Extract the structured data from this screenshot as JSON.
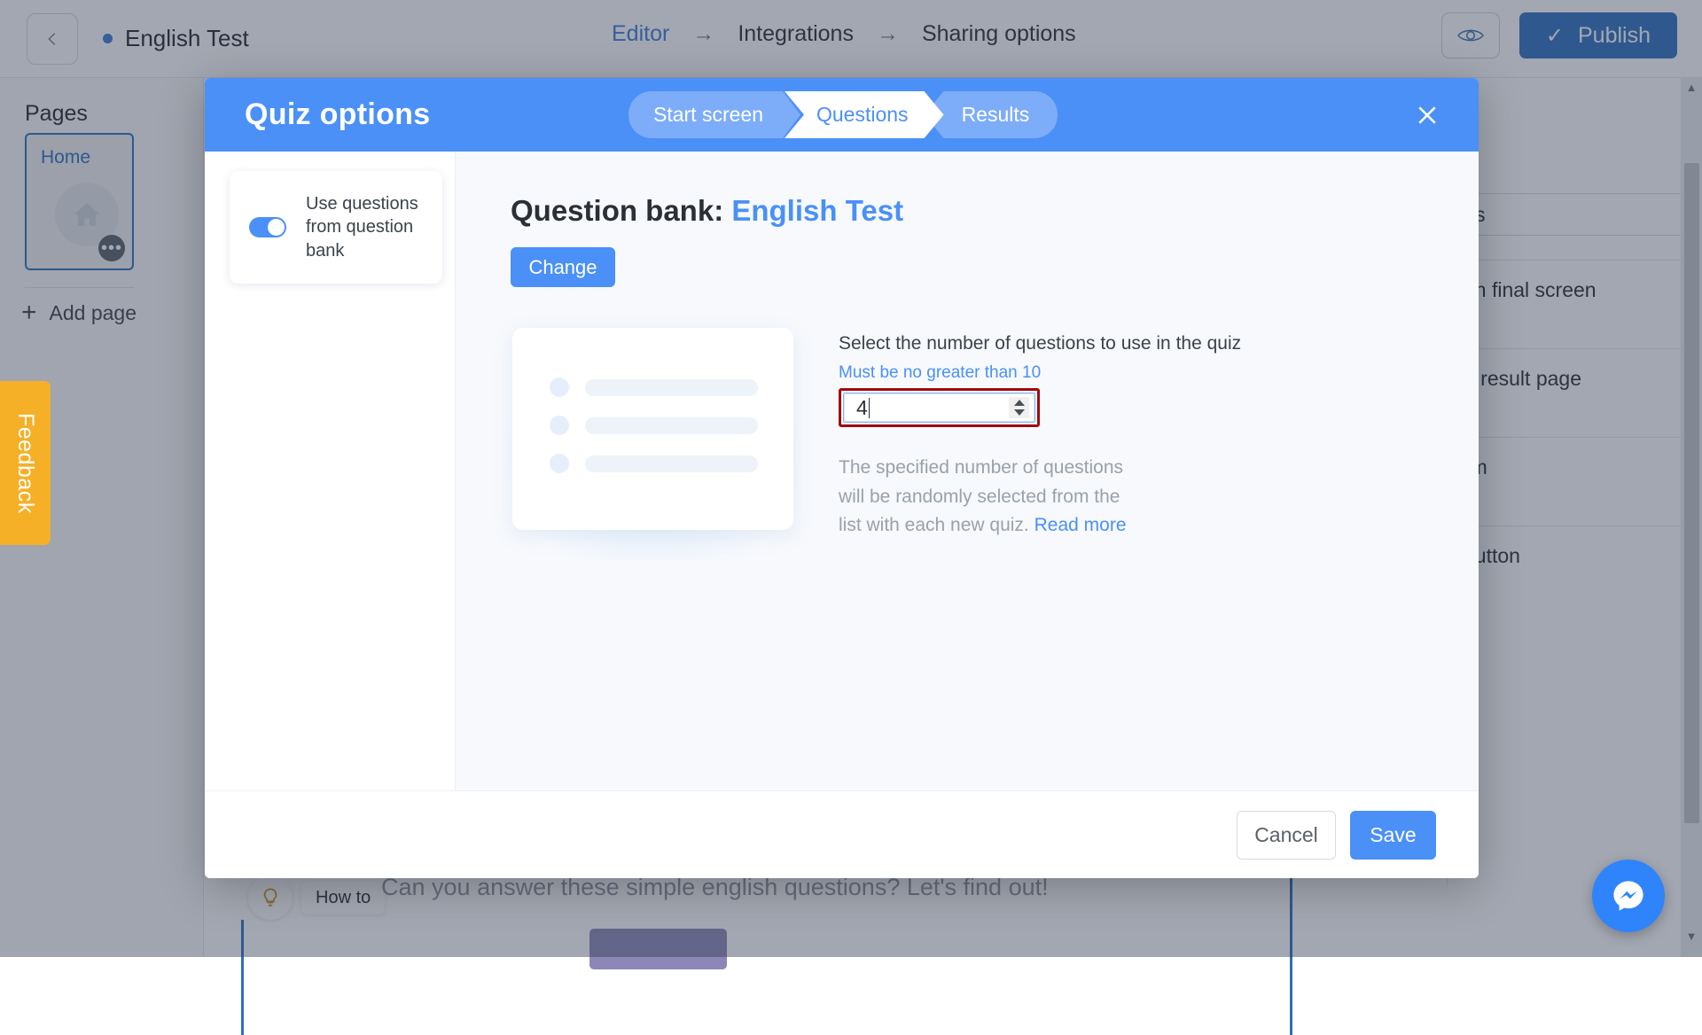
{
  "topbar": {
    "back_icon": "chevron-left-icon",
    "project_title": "English Test",
    "breadcrumb": [
      {
        "label": "Editor",
        "active": true
      },
      {
        "label": "Integrations",
        "active": false
      },
      {
        "label": "Sharing options",
        "active": false
      }
    ],
    "breadcrumb_separator": "→",
    "preview_icon": "eye-icon",
    "publish_label": "Publish",
    "publish_check": "✓",
    "publish_color": "#2f6fc0"
  },
  "pages_panel": {
    "title": "Pages",
    "page_card": {
      "label": "Home",
      "thumb_icon": "home-icon",
      "more_icon": "ellipsis-icon",
      "more_glyph": "•••"
    },
    "add_page_label": "Add page",
    "add_page_icon": "plus-icon"
  },
  "feedback_tab": {
    "label": "Feedback",
    "color": "#f5b028"
  },
  "canvas": {
    "howto_label": "How to",
    "howto_icon": "lightbulb-icon",
    "quiz_subtitle": "Can you answer these simple english questions? Let's find out!"
  },
  "right_panel": {
    "input_value": "s",
    "rows": [
      "on final screen",
      "n result page",
      "rm",
      " button"
    ]
  },
  "scrollbar": {
    "up_glyph": "▲",
    "down_glyph": "▼"
  },
  "messenger_fab": {
    "icon": "messenger-icon",
    "color": "#2f84fb"
  },
  "modal": {
    "title": "Quiz options",
    "close_icon": "close-icon",
    "header_color": "#4a90f7",
    "steps": [
      {
        "label": "Start screen",
        "active": false
      },
      {
        "label": "Questions",
        "active": true
      },
      {
        "label": "Results",
        "active": false
      }
    ],
    "left_panel": {
      "toggle": {
        "label": "Use questions from question bank",
        "state": "on"
      }
    },
    "content": {
      "heading_prefix": "Question bank:",
      "heading_name": "English Test",
      "change_label": "Change",
      "skeleton_rows": 3,
      "number_field": {
        "label": "Select the number of questions to use in the quiz",
        "hint": "Must be no greater than 10",
        "value": "4",
        "max": 10,
        "spinner_up": "increment",
        "spinner_down": "decrement",
        "highlight_color": "#a00b0b"
      },
      "description": "The specified number of questions will be randomly selected from the list with each new quiz.",
      "description_link": "Read more"
    },
    "footer": {
      "cancel_label": "Cancel",
      "save_label": "Save"
    }
  }
}
